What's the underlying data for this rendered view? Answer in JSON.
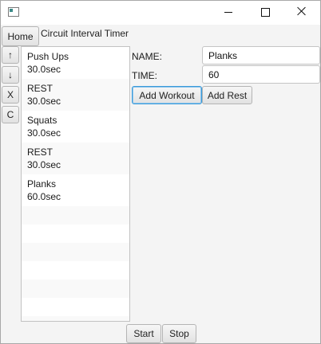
{
  "window": {
    "title": "",
    "controls": {
      "minimize": "minimize-icon",
      "maximize": "maximize-icon",
      "close": "close-icon"
    }
  },
  "toolbar": {
    "home_label": "Home",
    "app_title": "Circuit Interval Timer"
  },
  "side_buttons": {
    "up": "↑",
    "down": "↓",
    "delete": "X",
    "clear": "C"
  },
  "list": {
    "items": [
      {
        "name": "Push Ups",
        "time": "30.0sec"
      },
      {
        "name": "REST",
        "time": "30.0sec"
      },
      {
        "name": "Squats",
        "time": "30.0sec"
      },
      {
        "name": "REST",
        "time": "30.0sec"
      },
      {
        "name": "Planks",
        "time": "60.0sec"
      }
    ]
  },
  "form": {
    "name_label": "NAME:",
    "name_value": "Planks",
    "time_label": "TIME:",
    "time_value": "60",
    "add_workout_label": "Add Workout",
    "add_rest_label": "Add Rest"
  },
  "footer": {
    "start_label": "Start",
    "stop_label": "Stop"
  },
  "colors": {
    "background": "#f4f4f4",
    "focus_border": "#3a9ad9",
    "list_alt_row": "#f9f9f9"
  }
}
